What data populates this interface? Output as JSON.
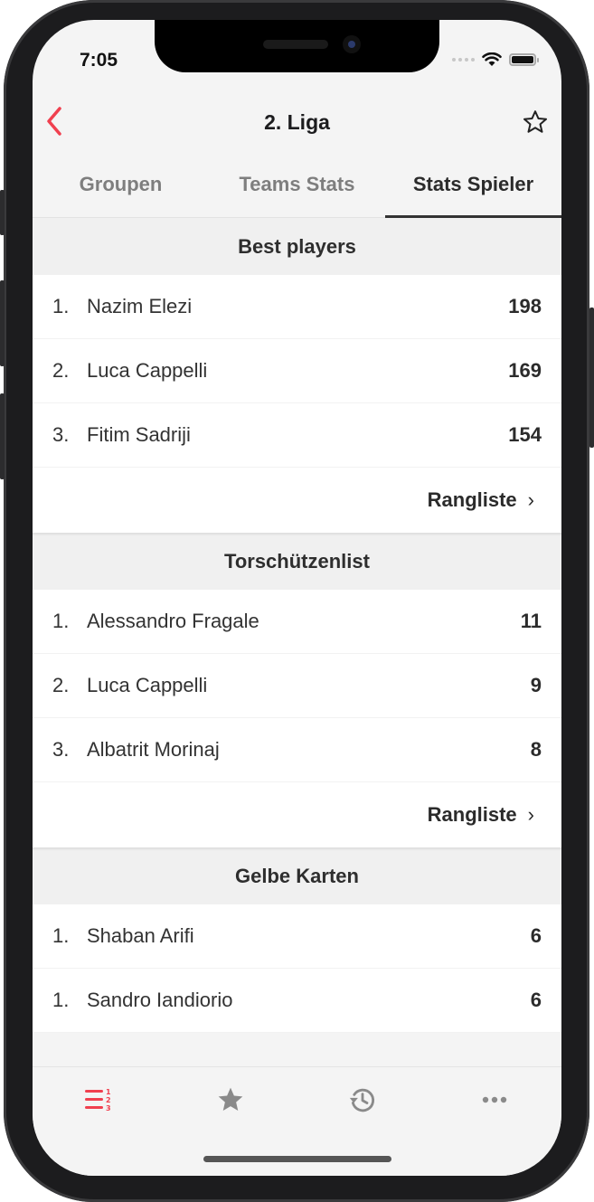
{
  "status_bar": {
    "time": "7:05"
  },
  "navbar": {
    "title": "2. Liga",
    "back_icon": "chevron-left-icon",
    "favorite_icon": "star-outline-icon"
  },
  "tabs": [
    {
      "label": "Groupen",
      "active": false
    },
    {
      "label": "Teams Stats",
      "active": false
    },
    {
      "label": "Stats Spieler",
      "active": true
    }
  ],
  "sections": [
    {
      "title": "Best players",
      "rows": [
        {
          "rank": "1.",
          "name": "Nazim Elezi",
          "value": "198"
        },
        {
          "rank": "2.",
          "name": "Luca Cappelli",
          "value": "169"
        },
        {
          "rank": "3.",
          "name": "Fitim Sadriji",
          "value": "154"
        }
      ],
      "more_label": "Rangliste"
    },
    {
      "title": "Torschützenlist",
      "rows": [
        {
          "rank": "1.",
          "name": "Alessandro Fragale",
          "value": "11"
        },
        {
          "rank": "2.",
          "name": "Luca Cappelli",
          "value": "9"
        },
        {
          "rank": "3.",
          "name": "Albatrit Morinaj",
          "value": "8"
        }
      ],
      "more_label": "Rangliste"
    },
    {
      "title": "Gelbe Karten",
      "rows": [
        {
          "rank": "1.",
          "name": "Shaban Arifi",
          "value": "6"
        },
        {
          "rank": "1.",
          "name": "Sandro Iandiorio",
          "value": "6"
        }
      ]
    }
  ],
  "tab_bar": [
    {
      "icon": "ranking-list-icon",
      "active": true
    },
    {
      "icon": "star-icon",
      "active": false
    },
    {
      "icon": "history-icon",
      "active": false
    },
    {
      "icon": "more-icon",
      "active": false
    }
  ],
  "colors": {
    "accent": "#f0404f",
    "inactive_icon": "#8a8a8a"
  }
}
